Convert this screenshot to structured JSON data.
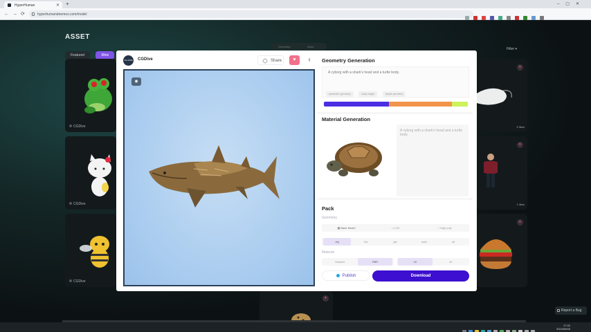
{
  "browser": {
    "tab_title": "HyperHuman",
    "url": "hyperhumandeemos.com/model"
  },
  "page": {
    "title": "ASSET",
    "filters": [
      "Featured",
      "Mine"
    ],
    "active_filter": "Mine",
    "mode_tabs": [
      "Geometry",
      "Node"
    ],
    "filter_button": "Filter",
    "report_bug": "Report a Bug",
    "cards": [
      {
        "author": "CGDive",
        "count": ""
      },
      {
        "author": "CGDive",
        "count": ""
      },
      {
        "author": "CGDive",
        "count": ""
      },
      {
        "author": "",
        "count": "0 likes"
      },
      {
        "author": "",
        "count": "1 likes"
      },
      {
        "author": "",
        "count": ""
      }
    ]
  },
  "modal": {
    "creator": "CGDive",
    "avatar_text": "CG DIVE",
    "share_label": "Share",
    "geometry": {
      "title": "Geometry Generation",
      "prompt": "A cyborg with a shark's head and a turtle body.",
      "tags": [
        "symmetric geometry",
        "sharp edges",
        "simple geometry"
      ],
      "progress_segments": [
        {
          "fraction": 0.45,
          "color": "#4b2ee3"
        },
        {
          "fraction": 0.44,
          "color": "#f2954b"
        },
        {
          "fraction": 0.11,
          "color": "#cdf25a"
        }
      ]
    },
    "material": {
      "title": "Material Generation",
      "prompt": "A cyborg with a shark's head and a turtle body."
    },
    "pack": {
      "title": "Pack",
      "geometry_label": "Geometry",
      "model_options": [
        "Base Model",
        "LOD",
        "High poly"
      ],
      "selected_model": "Base Model",
      "formats": [
        "obj",
        "fbx",
        "glb",
        "usdz",
        "stl"
      ],
      "selected_format": "obj",
      "material_label": "Material",
      "material_options": [
        "Shaded",
        "PBR"
      ],
      "selected_material": "PBR",
      "resolutions": [
        "1K",
        "4K"
      ],
      "selected_resolution": "1K"
    },
    "publish_label": "Publish",
    "download_label": "Download"
  },
  "taskbar": {
    "time": "17:42",
    "date": "2024/06/05"
  },
  "colors": {
    "accent": "#3d0fd0",
    "favorite": "#f2708a",
    "viewport_bg": "#a8cbef"
  }
}
